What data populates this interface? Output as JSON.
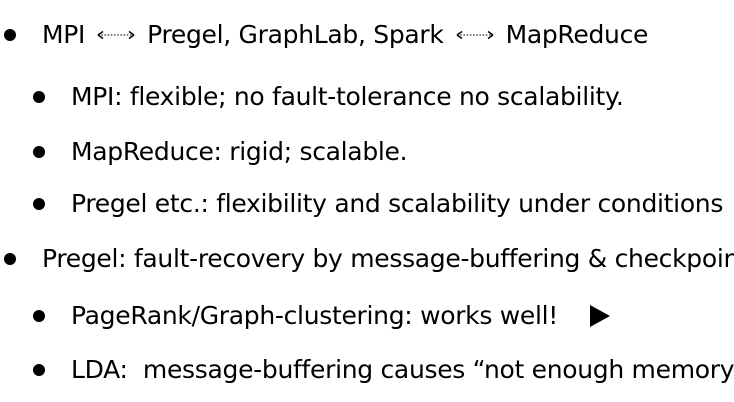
{
  "bullets": {
    "b1": {
      "part1": "MPI",
      "part2": "Pregel, GraphLab, Spark",
      "part3": "MapReduce"
    },
    "b1_1": "MPI: flexible; no fault-tolerance no scalability.",
    "b1_2": "MapReduce: rigid; scalable.",
    "b1_3": "Pregel etc.: flexibility and scalability under conditions",
    "b2": "Pregel: fault-recovery by message-buffering & checkpoint",
    "b2_1": "PageRank/Graph-clustering: works well!",
    "b2_2": "LDA:  message-buffering causes “not enough memory”."
  },
  "icons": {
    "arrow": "double-headed-arrow-icon",
    "play": "play-icon"
  }
}
